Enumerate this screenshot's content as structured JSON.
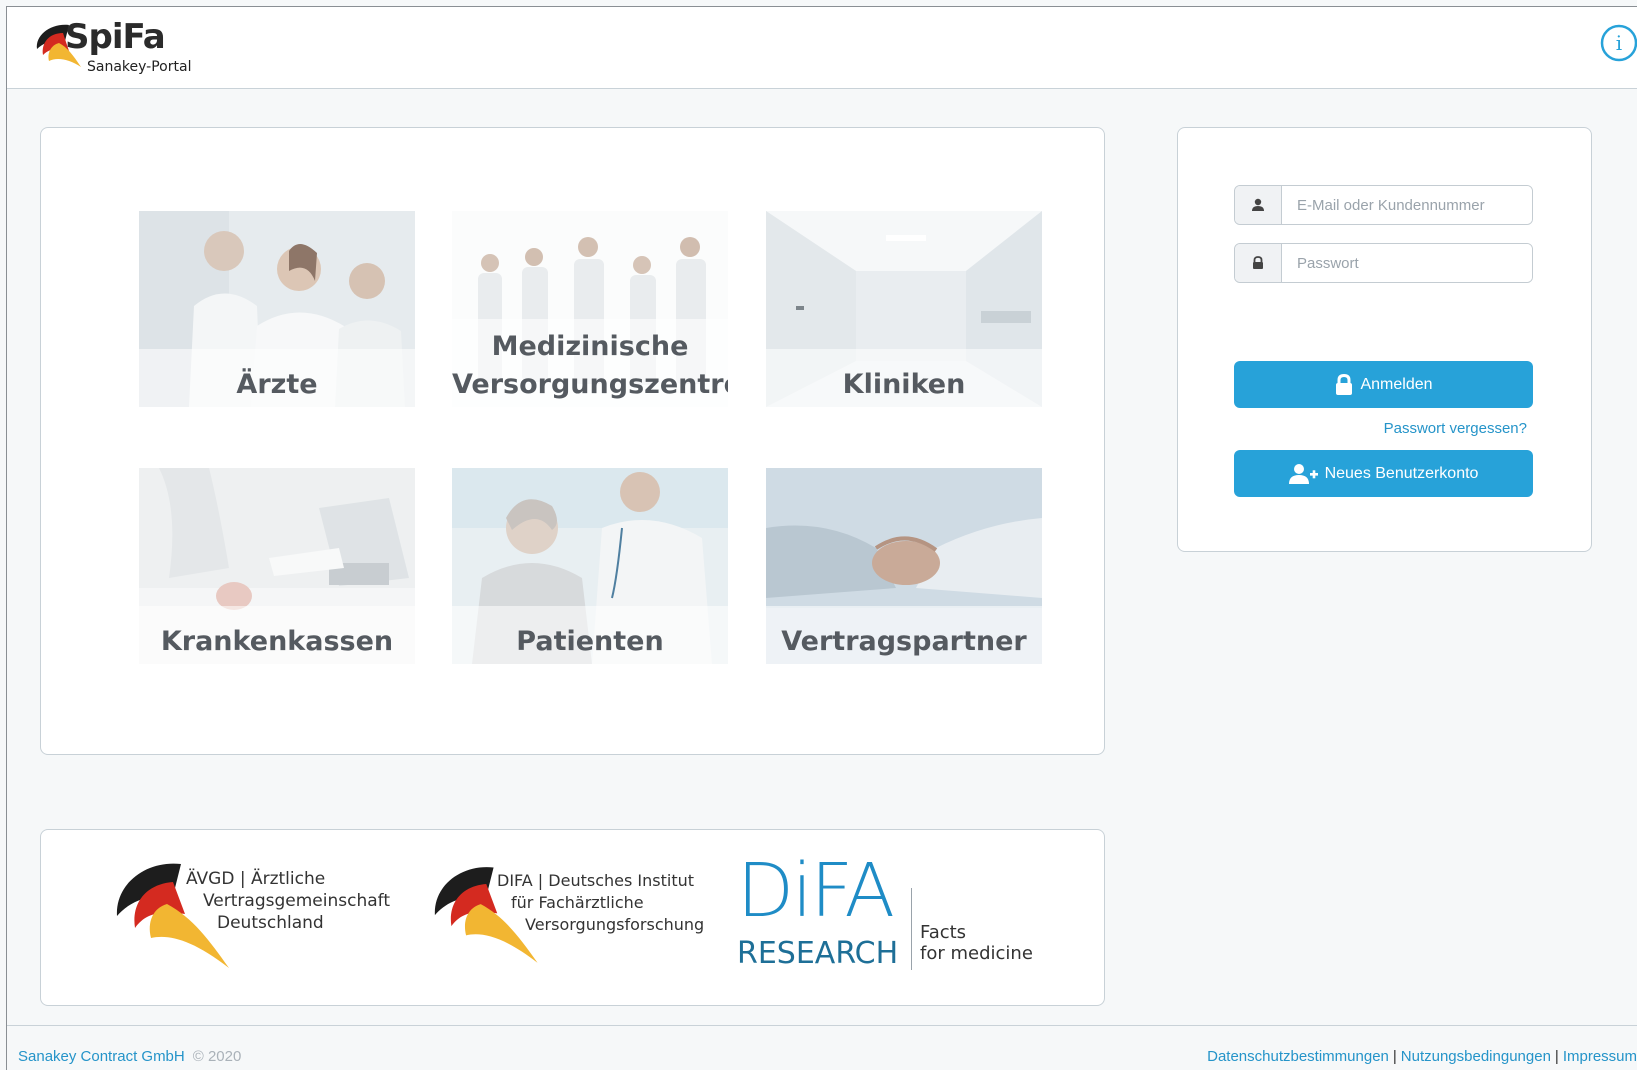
{
  "header": {
    "logo_word": "SpiFa",
    "logo_sub": "Sanakey-Portal"
  },
  "tiles": [
    {
      "label": "Ärzte",
      "icon": "doctors-photo"
    },
    {
      "label_line1": "Medizinische",
      "label_line2": "Versorgungszentren",
      "icon": "team-photo"
    },
    {
      "label": "Kliniken",
      "icon": "hospital-corridor-photo"
    },
    {
      "label": "Krankenkassen",
      "icon": "insurance-desk-photo"
    },
    {
      "label": "Patienten",
      "icon": "patient-exam-photo"
    },
    {
      "label": "Vertragspartner",
      "icon": "handshake-photo"
    }
  ],
  "login": {
    "email_placeholder": "E-Mail oder Kundennummer",
    "password_placeholder": "Passwort",
    "login_button": "Anmelden",
    "forgot_link": "Passwort vergessen?",
    "register_button": "Neues Benutzerkonto"
  },
  "partners": {
    "avgd": {
      "line1": "ÄVGD | Ärztliche",
      "line2": "Vertragsgemeinschaft",
      "line3": "Deutschland"
    },
    "difa": {
      "line1": "DIFA | Deutsches Institut",
      "line2": "für Fachärztliche",
      "line3": "Versorgungsforschung"
    },
    "research": {
      "big": "DiFA",
      "word": "RESEARCH",
      "tag1": "Facts",
      "tag2": "for medicine"
    }
  },
  "footer": {
    "company": "Sanakey Contract GmbH",
    "copyright": "© 2020",
    "links": [
      "Datenschutzbestimmungen",
      "Nutzungsbedingungen",
      "Impressum"
    ]
  },
  "colors": {
    "accent": "#27a2d9",
    "link": "#2594c9",
    "brand_red": "#d42a20",
    "brand_yellow": "#f2b632"
  }
}
